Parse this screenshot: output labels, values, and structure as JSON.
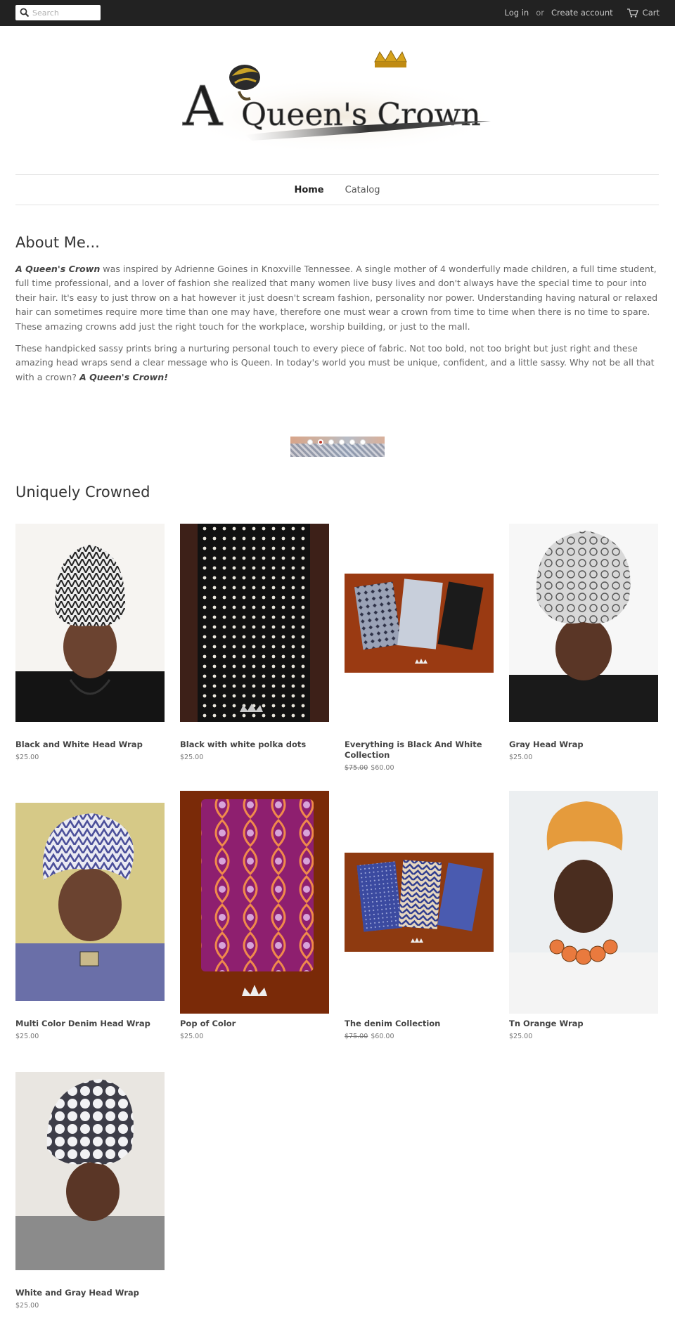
{
  "topbar": {
    "search_placeholder": "Search",
    "login": "Log in",
    "or": "or",
    "create_account": "Create account",
    "cart": "Cart"
  },
  "logo": {
    "text_1": "A",
    "text_2": "Queen's Crown"
  },
  "nav": {
    "home": "Home",
    "catalog": "Catalog"
  },
  "about": {
    "title": "About Me...",
    "brand": "A Queen's Crown",
    "para1": " was inspired by Adrienne Goines in Knoxville Tennessee. A single mother of 4 wonderfully made children, a full time student, full time professional, and a lover of fashion she realized that many women live busy lives and don't always have the special time to pour into their hair.  It's easy to just throw on a hat however it just doesn't scream fashion, personality nor power.  Understanding having natural or relaxed hair can sometimes require more time than one may have, therefore one must wear a crown from time to time when there is no time to spare. These amazing crowns add just the right touch for the workplace, worship building, or just to the mall.",
    "para2": " These handpicked sassy prints bring a nurturing personal touch to every piece of fabric.  Not too bold, not too bright but just right and these amazing head wraps send a clear message who is Queen. In today's world you must be unique, confident, and a little sassy. Why not be all that with a crown?  ",
    "brand2": "A Queen's Crown!"
  },
  "section_title": "Uniquely Crowned",
  "products": [
    {
      "name": "Black and White Head Wrap",
      "price": "$25.00",
      "compare": ""
    },
    {
      "name": "Black with white polka dots",
      "price": "$25.00",
      "compare": ""
    },
    {
      "name": "Everything is Black And White Collection",
      "price": "$60.00",
      "compare": "$75.00"
    },
    {
      "name": "Gray Head Wrap",
      "price": "$25.00",
      "compare": ""
    },
    {
      "name": "Multi Color Denim Head Wrap",
      "price": "$25.00",
      "compare": ""
    },
    {
      "name": "Pop of Color",
      "price": "$25.00",
      "compare": ""
    },
    {
      "name": "The denim Collection",
      "price": "$60.00",
      "compare": "$75.00"
    },
    {
      "name": "Tn Orange Wrap",
      "price": "$25.00",
      "compare": ""
    },
    {
      "name": "White and Gray Head Wrap",
      "price": "$25.00",
      "compare": ""
    }
  ],
  "colors": {
    "topbar": "#222222",
    "accent": "#c0392b"
  }
}
